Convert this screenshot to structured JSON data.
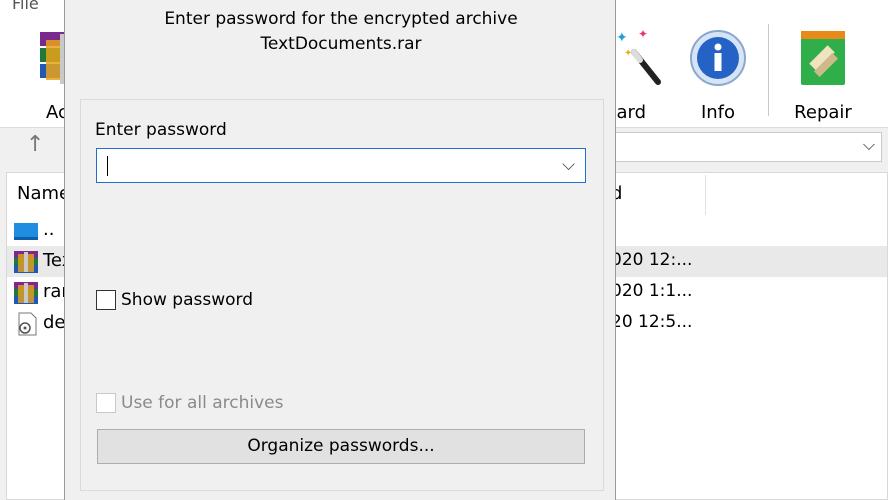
{
  "menu": {
    "file_label": "File"
  },
  "toolbar": {
    "add_label": "Ac",
    "wizard_label": "izard",
    "info_label": "Info",
    "repair_label": "Repair",
    "add_icon": "winrar-add-icon",
    "wizard_icon": "magic-wand-icon",
    "info_icon": "info-icon",
    "repair_icon": "repair-icon"
  },
  "addressbar": {
    "up_icon": "up-arrow-icon",
    "dropdown_icon": "chevron-down-icon"
  },
  "filelist": {
    "columns": {
      "name": "Name",
      "modified": "d"
    },
    "rows": [
      {
        "name": "..",
        "date": "",
        "icon": "folder-up-icon",
        "selected": false
      },
      {
        "name": "Tex",
        "date": "020 12:...",
        "icon": "rar-archive-icon",
        "selected": true
      },
      {
        "name": "rar",
        "date": "020 1:1...",
        "icon": "rar-archive-icon",
        "selected": false
      },
      {
        "name": "de",
        "date": "20 12:5...",
        "icon": "settings-file-icon",
        "selected": false
      }
    ]
  },
  "dialog": {
    "title_line1": "Enter password for the encrypted archive",
    "title_line2": "TextDocuments.rar",
    "password_label": "Enter password",
    "password_value": "",
    "show_password_label": "Show password",
    "show_password_checked": false,
    "use_for_all_label": "Use for all archives",
    "use_for_all_checked": false,
    "organize_button": "Organize passwords..."
  },
  "colors": {
    "accent_border": "#1e6fd0",
    "dialog_bg": "#f0f0f0",
    "selection": "#e9e9e9"
  }
}
